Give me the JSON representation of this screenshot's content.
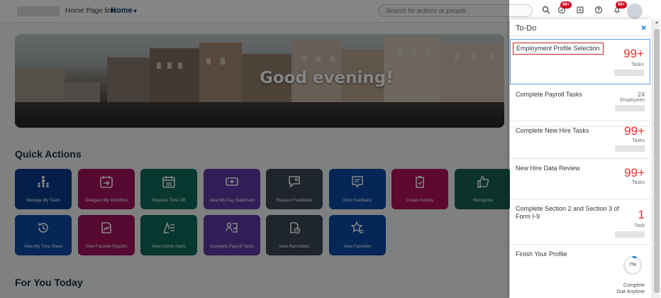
{
  "topbar": {
    "home_page_link": "Home Page link",
    "home_label": "Home",
    "search_placeholder": "Search for actions or people",
    "badges": {
      "notifications_primary": "99+",
      "notifications_secondary": "99+"
    }
  },
  "hero": {
    "greeting": "Good evening!"
  },
  "quick_actions": {
    "title": "Quick Actions",
    "tiles": [
      {
        "label": "Manage My Team",
        "icon": "team-icon"
      },
      {
        "label": "Delegate My Workflow",
        "icon": "calendar-forward-icon"
      },
      {
        "label": "Request Time Off",
        "icon": "calendar-icon"
      },
      {
        "label": "View My Pay Statement",
        "icon": "money-bills-icon"
      },
      {
        "label": "Request Feedback",
        "icon": "feedback-request-icon"
      },
      {
        "label": "Give Feedback",
        "icon": "give-feedback-icon"
      },
      {
        "label": "Create Activity",
        "icon": "clipboard-icon"
      },
      {
        "label": "Recognize",
        "icon": "thumbs-up-icon"
      },
      {
        "label": "View My Time Sheet",
        "icon": "history-icon"
      },
      {
        "label": "View Favorite Reports",
        "icon": "report-icon"
      },
      {
        "label": "View Admin Alerts",
        "icon": "admin-alerts-icon"
      },
      {
        "label": "Complete Payroll Tasks",
        "icon": "payroll-tasks-icon"
      },
      {
        "label": "View Reminders",
        "icon": "reminder-icon"
      },
      {
        "label": "View Favorites",
        "icon": "favorites-icon"
      }
    ]
  },
  "for_you_today": {
    "title": "For You Today"
  },
  "todo": {
    "title": "To-Do",
    "close": "×",
    "items": [
      {
        "name": "Employment Profile Selection",
        "count": "99+",
        "unit": "Tasks"
      },
      {
        "name": "Complete Payroll Tasks",
        "count": "24",
        "unit": "Employees"
      },
      {
        "name": "Complete New Hire Tasks",
        "count": "99+",
        "unit": "Tasks"
      },
      {
        "name": "New Hire Data Review",
        "count": "99+",
        "unit": "Tasks"
      },
      {
        "name": "Complete Section 2 and Section 3 of Form I-9",
        "count": "1",
        "unit": "Task"
      },
      {
        "name": "Finish Your Profile",
        "progress_label": "7%",
        "progress": 0.07,
        "status": "Complete",
        "due": "Due Anytime"
      }
    ]
  },
  "colors": {
    "accent": "#0a6ed1",
    "count_red": "#e9302f",
    "badge_red": "#d0021b",
    "selection_red": "#d0271d"
  }
}
